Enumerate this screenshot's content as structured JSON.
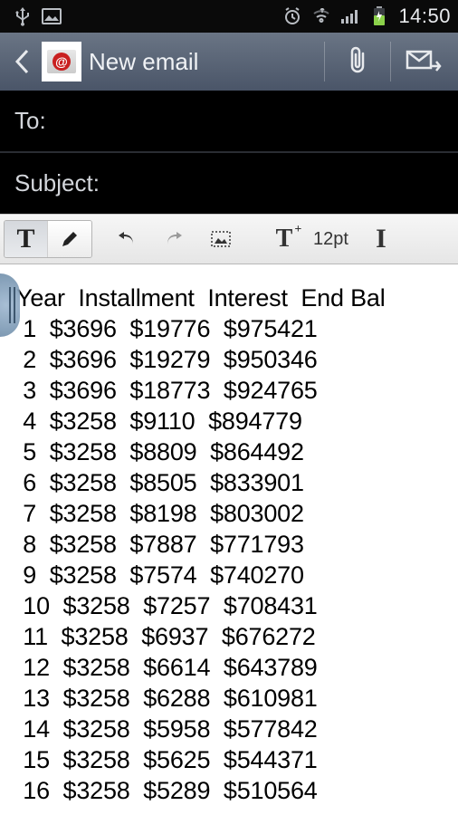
{
  "status": {
    "time": "14:50"
  },
  "header": {
    "title": "New email"
  },
  "fields": {
    "to_label": "To:",
    "subject_label": "Subject:"
  },
  "toolbar": {
    "font_size": "12pt"
  },
  "chart_data": {
    "type": "table",
    "columns": [
      "Year",
      "Installment",
      "Interest",
      "End Bal"
    ],
    "rows": [
      {
        "year": 1,
        "installment": "$3696",
        "interest": "$19776",
        "end_bal": "$975421"
      },
      {
        "year": 2,
        "installment": "$3696",
        "interest": "$19279",
        "end_bal": "$950346"
      },
      {
        "year": 3,
        "installment": "$3696",
        "interest": "$18773",
        "end_bal": "$924765"
      },
      {
        "year": 4,
        "installment": "$3258",
        "interest": "$9110",
        "end_bal": "$894779"
      },
      {
        "year": 5,
        "installment": "$3258",
        "interest": "$8809",
        "end_bal": "$864492"
      },
      {
        "year": 6,
        "installment": "$3258",
        "interest": "$8505",
        "end_bal": "$833901"
      },
      {
        "year": 7,
        "installment": "$3258",
        "interest": "$8198",
        "end_bal": "$803002"
      },
      {
        "year": 8,
        "installment": "$3258",
        "interest": "$7887",
        "end_bal": "$771793"
      },
      {
        "year": 9,
        "installment": "$3258",
        "interest": "$7574",
        "end_bal": "$740270"
      },
      {
        "year": 10,
        "installment": "$3258",
        "interest": "$7257",
        "end_bal": "$708431"
      },
      {
        "year": 11,
        "installment": "$3258",
        "interest": "$6937",
        "end_bal": "$676272"
      },
      {
        "year": 12,
        "installment": "$3258",
        "interest": "$6614",
        "end_bal": "$643789"
      },
      {
        "year": 13,
        "installment": "$3258",
        "interest": "$6288",
        "end_bal": "$610981"
      },
      {
        "year": 14,
        "installment": "$3258",
        "interest": "$5958",
        "end_bal": "$577842"
      },
      {
        "year": 15,
        "installment": "$3258",
        "interest": "$5625",
        "end_bal": "$544371"
      },
      {
        "year": 16,
        "installment": "$3258",
        "interest": "$5289",
        "end_bal": "$510564"
      }
    ]
  }
}
